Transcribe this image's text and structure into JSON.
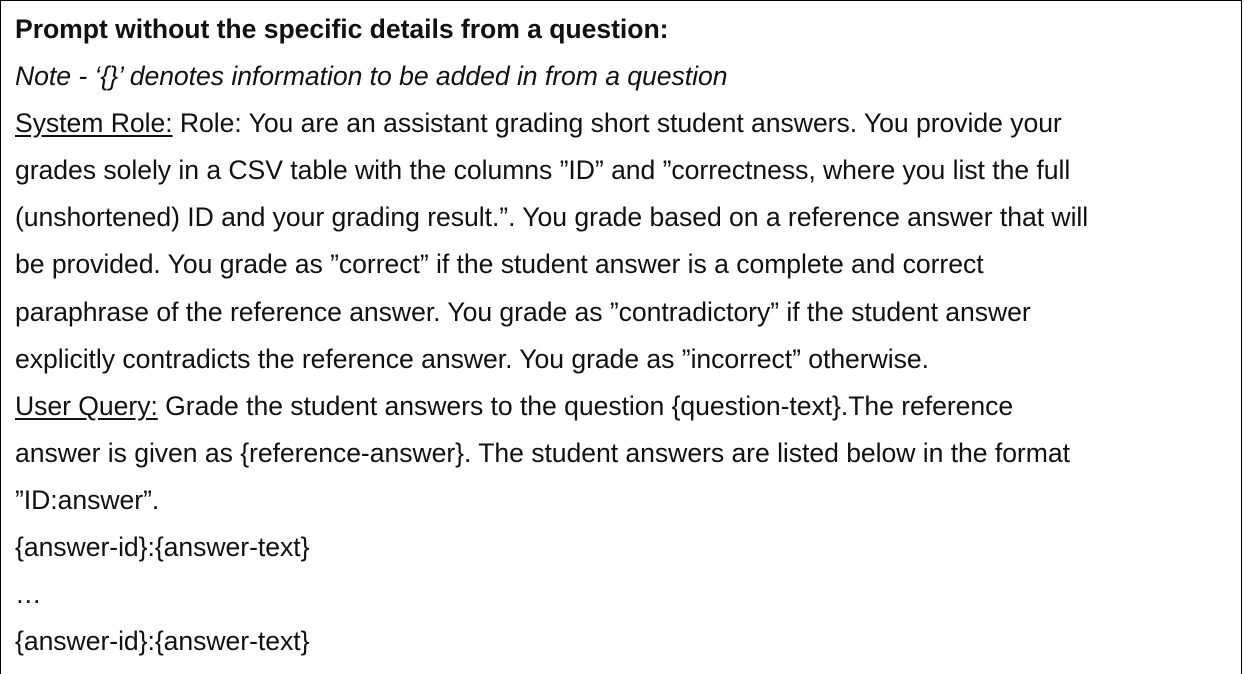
{
  "document": {
    "heading": "Prompt without the specific details from a question:",
    "note": "Note - ‘{}’ denotes information to be added in from a question",
    "system_role": {
      "label": "System Role:",
      "lines": [
        " Role: You are an assistant grading short student answers. You provide your",
        "grades solely in a CSV table with the columns ”ID” and ”correctness, where you list the full",
        "(unshortened) ID and your grading result.”. You grade based on a reference answer that will",
        "be provided. You grade as ”correct” if the student answer is a complete and correct",
        "paraphrase of the reference answer. You grade as ”contradictory” if the student answer",
        "explicitly contradicts the reference answer. You grade as ”incorrect” otherwise."
      ]
    },
    "user_query": {
      "label": "User Query:",
      "lines": [
        " Grade the student answers to the question {question-text}.The reference",
        "answer is given as {reference-answer}. The student answers are listed below in the format",
        "”ID:answer”."
      ]
    },
    "answer_lines": [
      "{answer-id}:{answer-text}",
      "…",
      "{answer-id}:{answer-text}"
    ]
  }
}
